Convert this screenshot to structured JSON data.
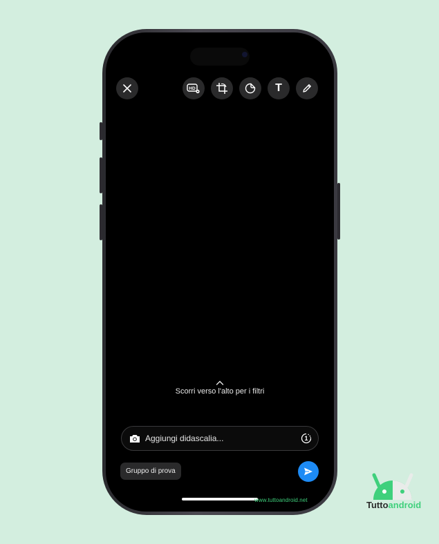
{
  "toolbar": {
    "close_icon": "close-icon",
    "hd_icon": "hd-settings-icon",
    "crop_icon": "crop-rotate-icon",
    "sticker_icon": "sticker-icon",
    "text_label": "T",
    "draw_icon": "pencil-icon"
  },
  "hint": {
    "text": "Scorri verso l'alto per i filtri",
    "icon": "chevron-up-icon"
  },
  "caption": {
    "placeholder": "Aggiungi didascalia...",
    "camera_icon": "camera-icon",
    "view_once_icon": "view-once-icon",
    "view_once_label": "1"
  },
  "recipient": {
    "label": "Gruppo di prova"
  },
  "send": {
    "icon": "send-icon",
    "color": "#1d8bf5"
  },
  "watermark": {
    "text": "www.tuttoandroid.net"
  },
  "brand": {
    "part1": "Tutto",
    "part2": "android",
    "logo_icon": "android-robot-logo",
    "accent": "#3fd07c"
  },
  "colors": {
    "background": "#d3eedf",
    "screen": "#000000",
    "button_bg": "#2a2a2b"
  }
}
